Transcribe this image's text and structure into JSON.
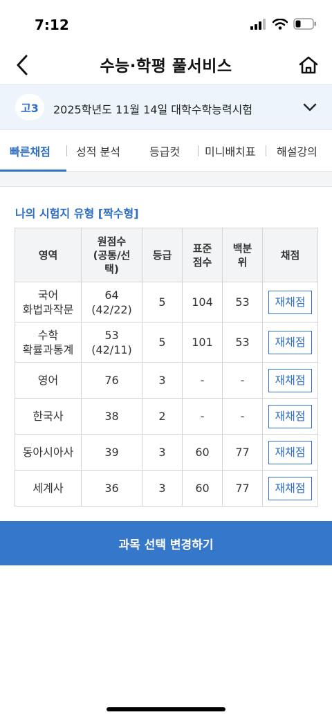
{
  "status_bar": {
    "time": "7:12"
  },
  "header": {
    "title": "수능·학평 풀서비스"
  },
  "exam": {
    "grade": "고3",
    "title": "2025학년도 11월 14일 대학수학능력시험"
  },
  "tabs": [
    "빠른채점",
    "성적 분석",
    "등급컷",
    "미니배치표",
    "해설강의"
  ],
  "section": {
    "title": "나의 시험지 유형 [짝수형]"
  },
  "table": {
    "headers": {
      "subject": "영역",
      "raw": [
        "원점수",
        "(공통/선",
        "택)"
      ],
      "grade": "등급",
      "std": [
        "표준",
        "점수"
      ],
      "pct": [
        "백분",
        "위"
      ],
      "mark": "채점"
    },
    "rows": [
      {
        "subject": [
          "국어",
          "화법과작문"
        ],
        "raw": [
          "64",
          "(42/22)"
        ],
        "grade": "5",
        "std": "104",
        "pct": "53",
        "button": "재채점"
      },
      {
        "subject": [
          "수학",
          "확률과통계"
        ],
        "raw": [
          "53",
          "(42/11)"
        ],
        "grade": "5",
        "std": "101",
        "pct": "53",
        "button": "재채점"
      },
      {
        "subject": [
          "영어",
          ""
        ],
        "raw": [
          "76",
          ""
        ],
        "grade": "3",
        "std": "-",
        "pct": "-",
        "button": "재채점"
      },
      {
        "subject": [
          "한국사",
          ""
        ],
        "raw": [
          "38",
          ""
        ],
        "grade": "2",
        "std": "-",
        "pct": "-",
        "button": "재채점"
      },
      {
        "subject": [
          "동아시아사",
          ""
        ],
        "raw": [
          "39",
          ""
        ],
        "grade": "3",
        "std": "60",
        "pct": "77",
        "button": "재채점"
      },
      {
        "subject": [
          "세계사",
          ""
        ],
        "raw": [
          "36",
          ""
        ],
        "grade": "3",
        "std": "60",
        "pct": "77",
        "button": "재채점"
      }
    ]
  },
  "actions": {
    "change_subject": "과목 선택 변경하기"
  },
  "icons": {
    "back": "back-arrow-icon",
    "home": "home-icon",
    "toggle": "chevron-down-icon",
    "signal": "cellular-signal-icon",
    "wifi": "wifi-icon",
    "battery": "battery-icon"
  },
  "colors": {
    "accent": "#2f6fc4",
    "button_bg": "#3577c9",
    "banner_bg": "#eef4fb"
  }
}
